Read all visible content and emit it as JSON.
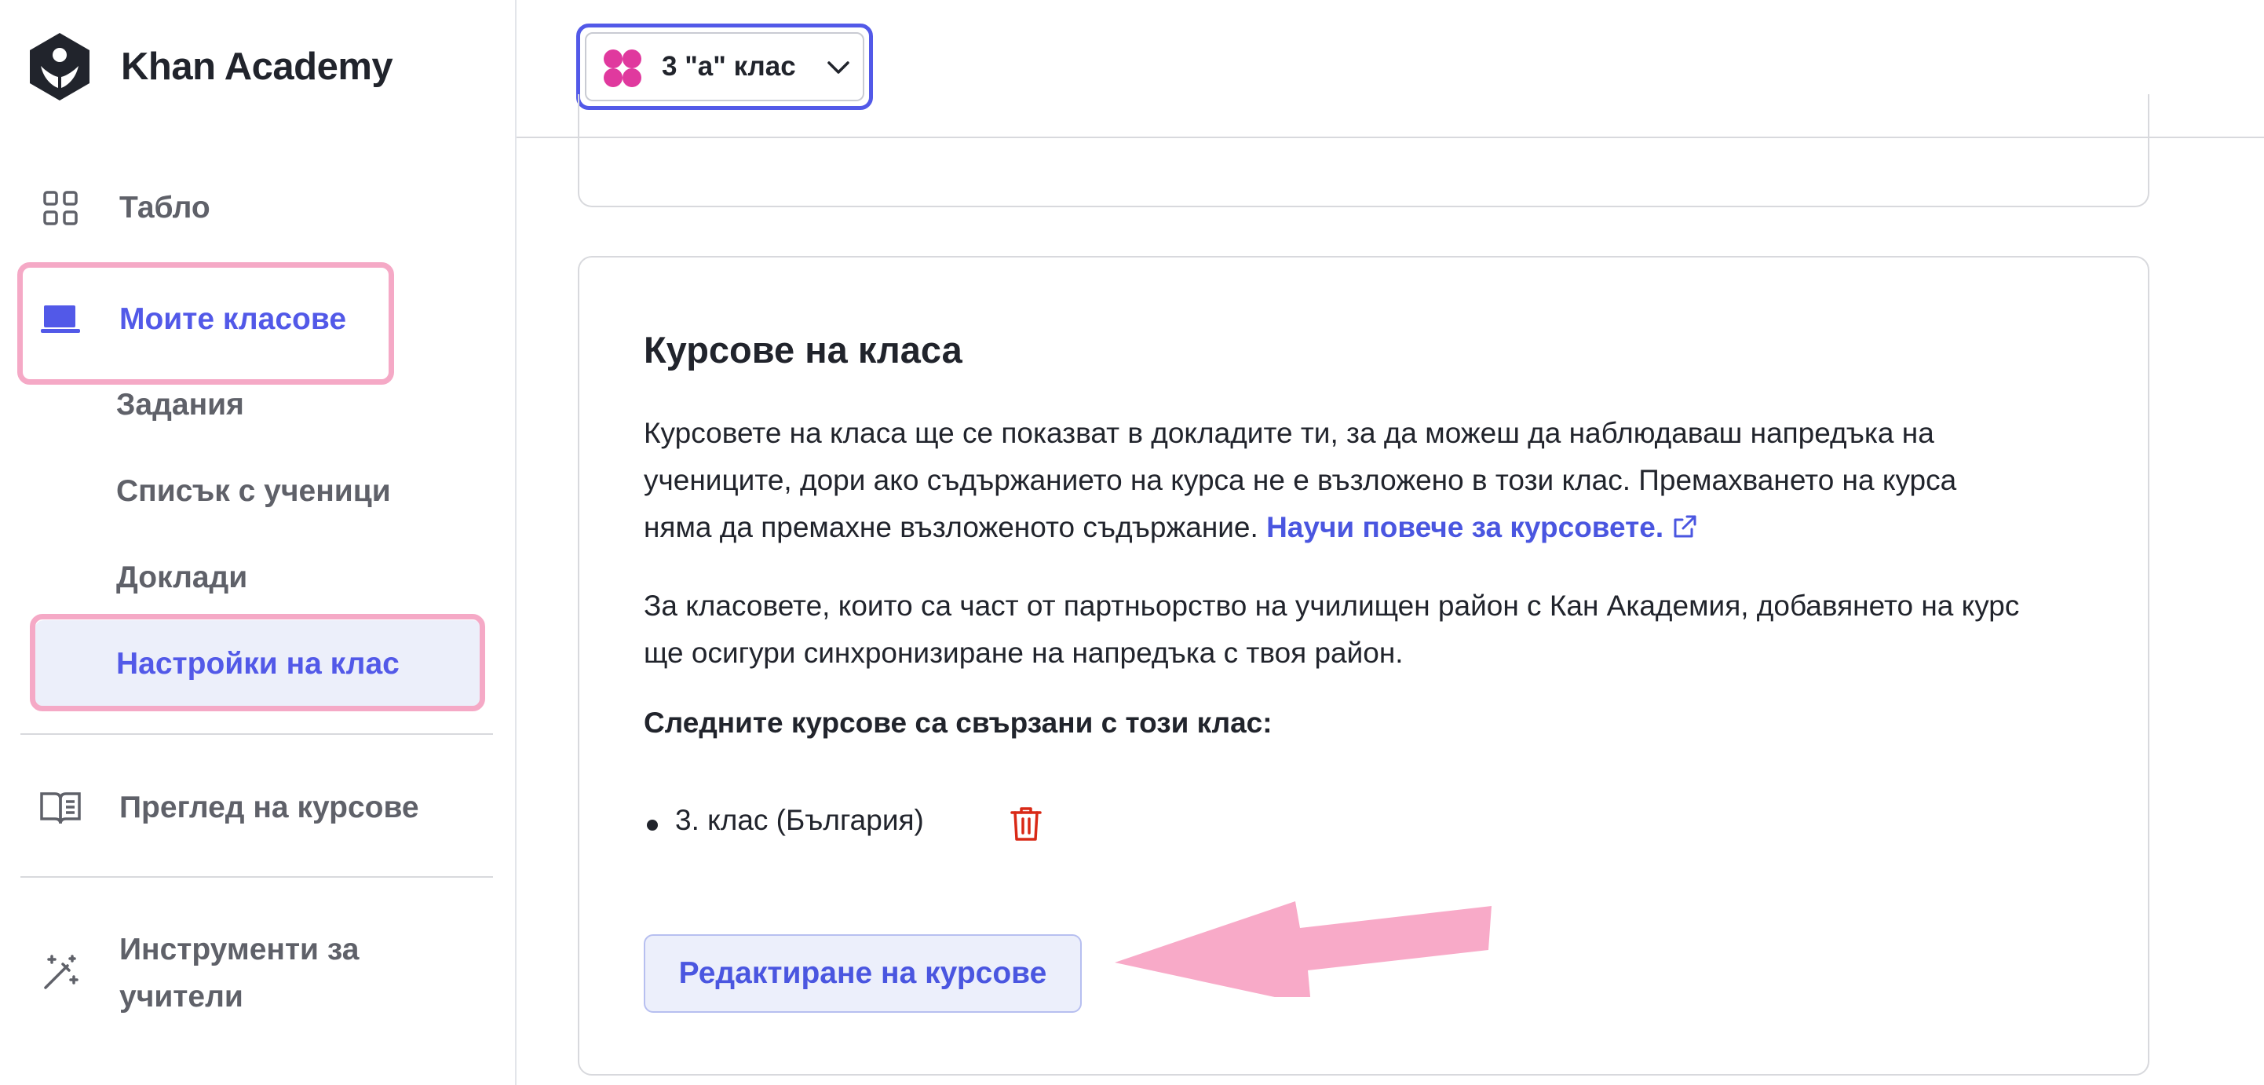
{
  "app": {
    "name": "Khan Academy"
  },
  "sidebar": {
    "items": [
      {
        "label": "Табло",
        "icon": "grid-icon"
      },
      {
        "label": "Моите класове",
        "icon": "classroom-icon",
        "active": true
      },
      {
        "label": "Преглед на курсове",
        "icon": "book-icon"
      },
      {
        "label": "Инструменти за учители",
        "line1": "Инструменти за",
        "line2": "учители",
        "icon": "magic-wand-icon"
      }
    ],
    "subitems": [
      {
        "label": "Задания"
      },
      {
        "label": "Списък с ученици"
      },
      {
        "label": "Доклади"
      },
      {
        "label": "Настройки на клас",
        "active": true
      }
    ]
  },
  "header": {
    "class_selector": {
      "value": "3 \"а\" клас",
      "icon": "class-avatar-icon"
    }
  },
  "card": {
    "title": "Курсове на класа",
    "paragraph1": {
      "line1": "Курсовете на класа ще се показват в докладите ти, за да можеш да наблюдаваш напредъка на",
      "line2": "учениците, дори ако съдържанието на курса не е възложено в този клас. Премахването на курса",
      "line3": "няма да премахне възложеното съдържание.",
      "link": "Научи повече за курсовете."
    },
    "paragraph2": {
      "line1": "За класовете, които са част от партньорство на училищен район с Кан Академия, добавянето на курс",
      "line2": "ще осигури синхронизиране на напредъка с твоя район."
    },
    "linked_heading": "Следните курсове са свързани с този клас:",
    "courses": [
      {
        "name": "3. клас (България)"
      }
    ],
    "edit_button": "Редактиране на курсове"
  },
  "colors": {
    "accent": "#5259e8",
    "highlight": "#f5a9c6",
    "danger": "#d92916",
    "class_icon": "#e0399e"
  }
}
